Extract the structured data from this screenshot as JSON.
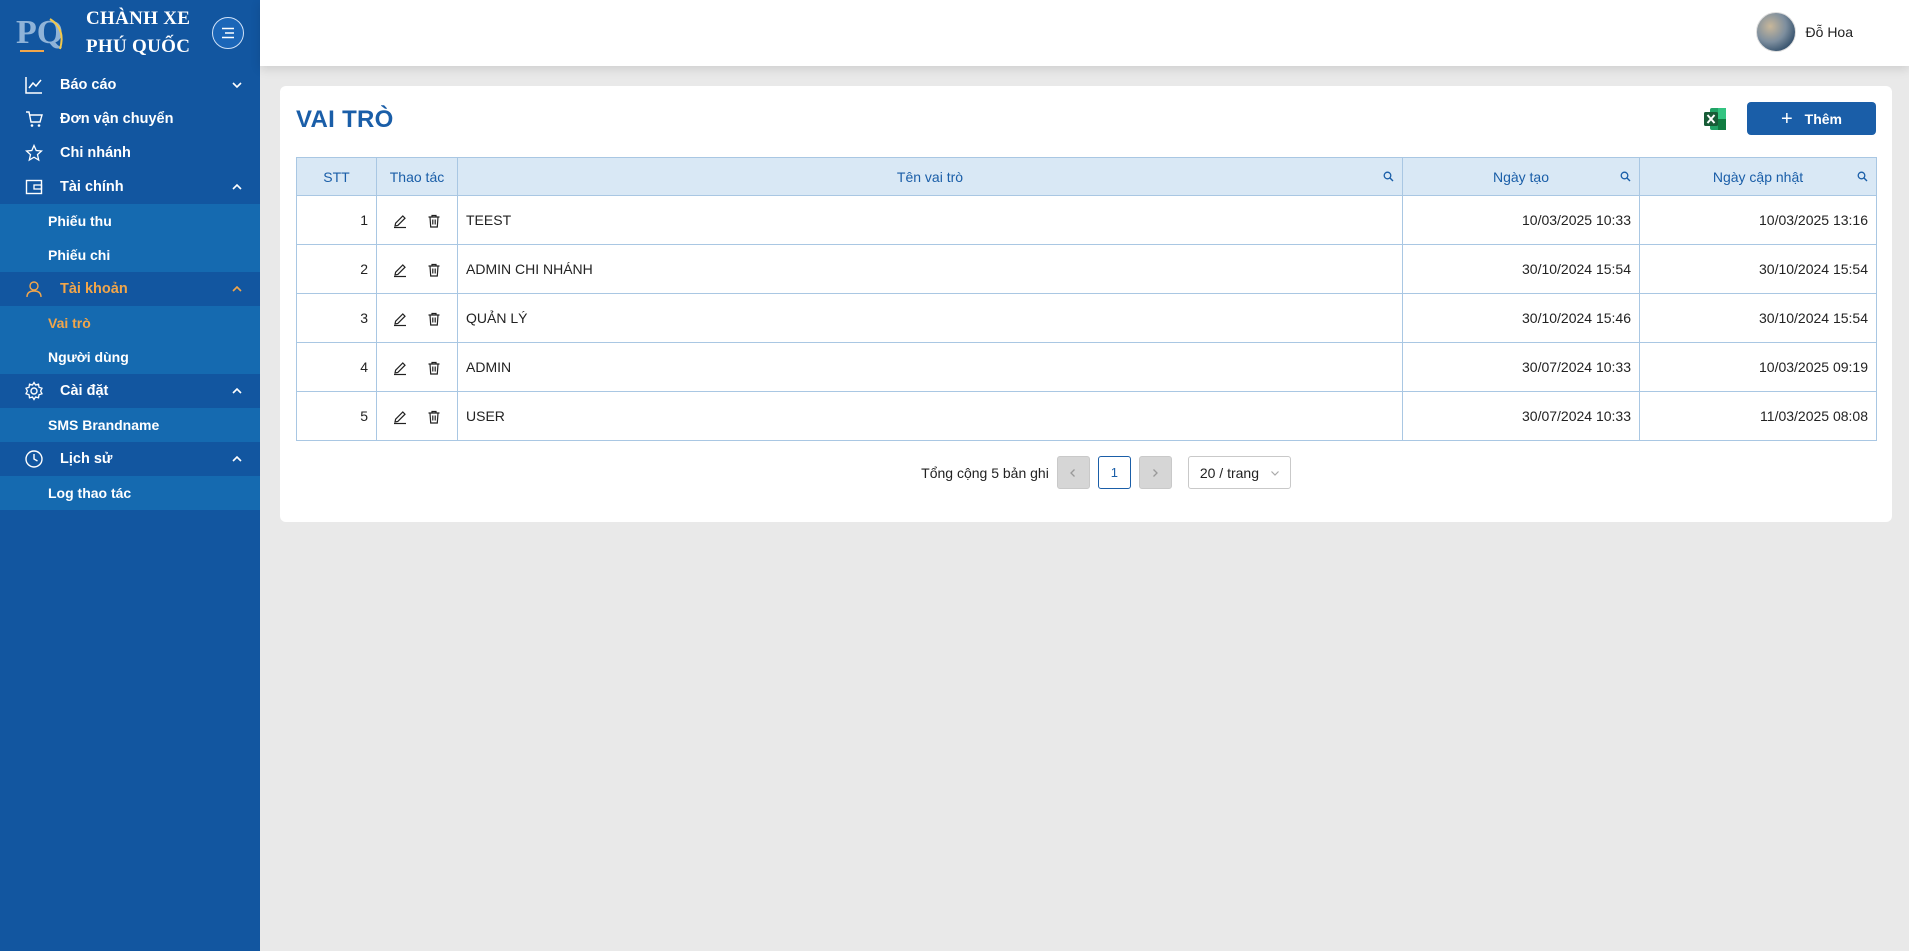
{
  "brand": {
    "line1": "CHÀNH XE",
    "line2": "PHÚ QUỐC",
    "logo_text": "PQ"
  },
  "sidebar": {
    "items": [
      {
        "label": "Báo cáo",
        "icon": "chart-line-icon"
      },
      {
        "label": "Đơn vận chuyển",
        "icon": "cart-icon"
      },
      {
        "label": "Chi nhánh",
        "icon": "star-icon"
      },
      {
        "label": "Tài chính",
        "icon": "wallet-icon",
        "sub": [
          "Phiếu thu",
          "Phiếu chi"
        ]
      },
      {
        "label": "Tài khoản",
        "icon": "user-icon",
        "sub": [
          "Vai trò",
          "Người dùng"
        ]
      },
      {
        "label": "Cài đặt",
        "icon": "gear-icon",
        "sub": [
          "SMS Brandname"
        ]
      },
      {
        "label": "Lịch sử",
        "icon": "clock-icon",
        "sub": [
          "Log thao tác"
        ]
      }
    ]
  },
  "header": {
    "user_name": "Đỗ Hoa"
  },
  "page": {
    "title": "VAI TRÒ",
    "add_label": "Thêm"
  },
  "table": {
    "columns": [
      "STT",
      "Thao tác",
      "Tên vai trò",
      "Ngày tạo",
      "Ngày cập nhật"
    ],
    "rows": [
      {
        "stt": "1",
        "name": "TEEST",
        "created": "10/03/2025 10:33",
        "updated": "10/03/2025 13:16"
      },
      {
        "stt": "2",
        "name": "ADMIN CHI NHÁNH",
        "created": "30/10/2024 15:54",
        "updated": "30/10/2024 15:54"
      },
      {
        "stt": "3",
        "name": "QUẢN LÝ",
        "created": "30/10/2024 15:46",
        "updated": "30/10/2024 15:54"
      },
      {
        "stt": "4",
        "name": "ADMIN",
        "created": "30/07/2024 10:33",
        "updated": "10/03/2025 09:19"
      },
      {
        "stt": "5",
        "name": "USER",
        "created": "30/07/2024 10:33",
        "updated": "11/03/2025 08:08"
      }
    ]
  },
  "pagination": {
    "total_text": "Tổng cộng 5 bản ghi",
    "current_page": "1",
    "page_size": "20 / trang"
  },
  "colors": {
    "sidebar": "#1256a0",
    "submenu": "#156ab0",
    "accent": "#1a5ea8",
    "active": "#f2a64a",
    "header_cell": "#d9e8f5"
  }
}
